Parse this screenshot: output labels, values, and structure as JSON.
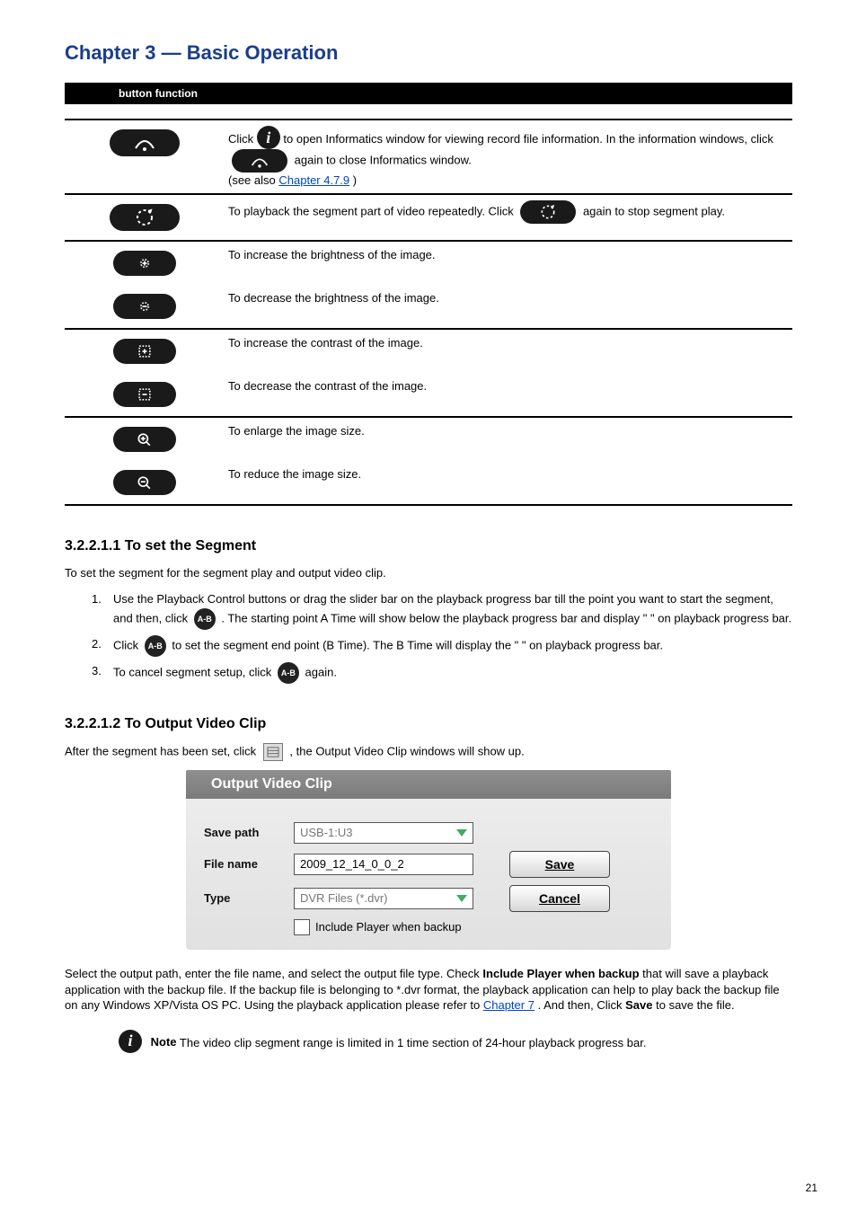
{
  "page_title": "Chapter 3 — Basic Operation",
  "page_number": "21",
  "blackbar": "button                            function",
  "table": {
    "rows": [
      {
        "icon_svg": "dome",
        "desc_leading": "Click ",
        "info_icon": "i",
        "desc_mid1": " to open Informatics window for viewing record file information. In the information windows, click ",
        "inline_svg": "dome",
        "desc_mid2": " again to close Informatics window. ",
        "see_also_label": "(see also ",
        "see_also_link": "Chapter 4.7.9",
        "see_also_tail": ")"
      },
      {
        "icon_svg": "loop",
        "desc_leading": "To playback the segment part of video repeatedly. Click ",
        "inline_svg": "loop",
        "desc_tail": " again to stop segment play."
      },
      {
        "rows": [
          {
            "icon_svg": "brightness-plus",
            "desc": "To increase the brightness of the image."
          },
          {
            "icon_svg": "brightness-minus",
            "desc": "To decrease the brightness of the image."
          }
        ]
      },
      {
        "rows": [
          {
            "icon_svg": "contrast-plus",
            "desc": "To increase the contrast of the image."
          },
          {
            "icon_svg": "contrast-minus",
            "desc": "To decrease the contrast of the image."
          }
        ]
      },
      {
        "rows": [
          {
            "icon_svg": "zoom-in",
            "desc": "To enlarge the image size."
          },
          {
            "icon_svg": "zoom-out",
            "desc": "To reduce the image size."
          }
        ]
      }
    ]
  },
  "segment": {
    "heading": "3.2.2.1.1 To set the Segment",
    "intro": "To set the segment for the segment play and output video clip.",
    "steps": [
      {
        "num": "1.",
        "text_a": "Use the Playback Control buttons or drag the slider bar on the playback progress bar till the point you want to start the segment, and then, click ",
        "icon": "A-B",
        "text_b": ". The starting point A Time will show below the playback progress bar and display \"",
        "mark_open": "",
        "mark": " ",
        "mark_close": "",
        "text_c": "\" on playback progress bar."
      },
      {
        "num": "2.",
        "text_a": "Click ",
        "icon": "A-B",
        "text_b": " to set the segment end point (B Time). The B Time will display the \"",
        "mark": " ",
        "text_c": "\" on playback progress bar."
      },
      {
        "num": "3.",
        "text_a": "To cancel segment setup, click ",
        "icon": "A-B",
        "text_b": " again."
      }
    ]
  },
  "output": {
    "heading": "3.2.2.1.2 To Output Video Clip",
    "body_a": "After the segment has been set, click ",
    "miniIcon": "⧉",
    "body_b": ", the Output Video Clip windows will show up.",
    "dialog": {
      "title": "Output Video Clip",
      "save_path_label": "Save path",
      "save_path_value": "USB-1:U3",
      "file_name_label": "File name",
      "file_name_value": "2009_12_14_0_0_2",
      "type_label": "Type",
      "type_value": "DVR Files (*.dvr)",
      "save_btn": "Save",
      "cancel_btn": "Cancel",
      "include_label": "Include Player when backup"
    },
    "footer_a": "Select the output path, enter the file name, and select the output file type. Check ",
    "footer_bold": "Include Player when backup",
    "footer_b": " that will save a playback application with the backup file. If the backup file is belonging to *.dvr format, the playback application can help to play back the backup file on any Windows XP/Vista OS PC. Using the playback application please refer to ",
    "footer_link": "Chapter 7",
    "footer_c": ". And then, Click ",
    "footer_save": "Save",
    "footer_d": " to save the file."
  },
  "note_label": "Note",
  "note_body": " The video clip segment range is limited in 1 time section of 24-hour playback progress bar."
}
